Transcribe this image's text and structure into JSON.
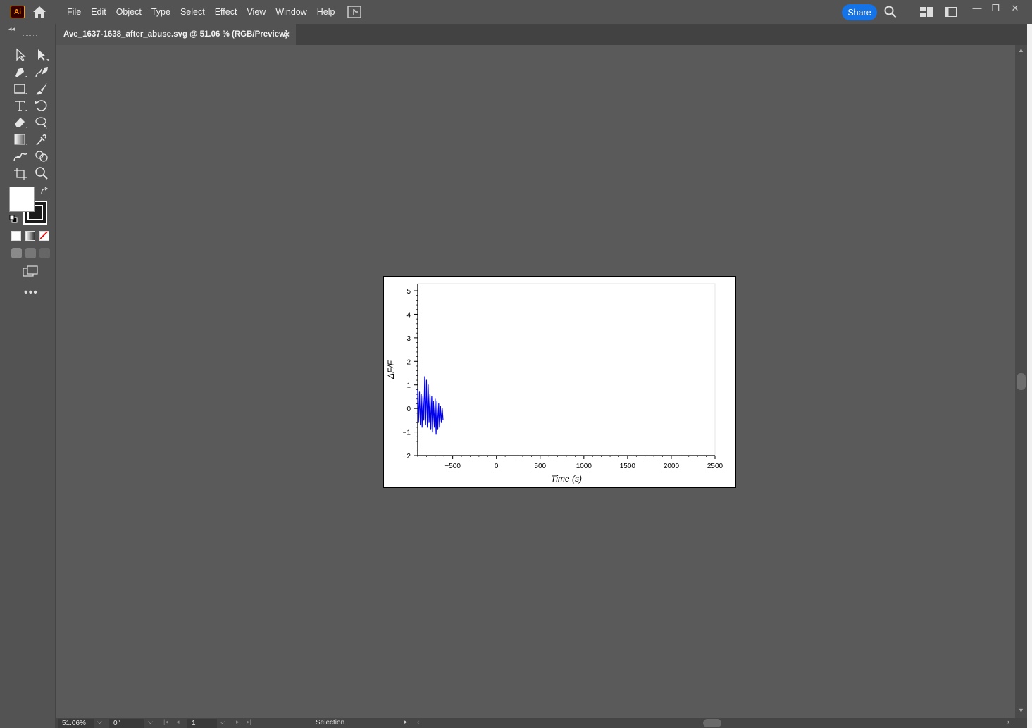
{
  "app": {
    "logo_text": "Ai"
  },
  "menu": [
    "File",
    "Edit",
    "Object",
    "Type",
    "Select",
    "Effect",
    "View",
    "Window",
    "Help"
  ],
  "share_label": "Share",
  "window_controls": {
    "minimize": "—",
    "restore": "❐",
    "close": "✕"
  },
  "document_tab": {
    "title": "Ave_1637-1638_after_abuse.svg @ 51.06 % (RGB/Preview)",
    "close": "×"
  },
  "toolbar": {
    "collapse": "◂◂",
    "more": "•••"
  },
  "status": {
    "zoom": "51.06%",
    "rotation": "0°",
    "artboard": "1",
    "tool": "Selection"
  },
  "colors": {
    "accent": "#1473e6",
    "series": "#0000ee",
    "ui_bg": "#535353"
  },
  "icons": [
    "home-icon",
    "arrange-documents-icon",
    "search-icon",
    "workspace-icon",
    "panel-icon",
    "selection-tool-icon",
    "direct-selection-tool-icon",
    "pen-tool-icon",
    "curvature-tool-icon",
    "rectangle-tool-icon",
    "paintbrush-tool-icon",
    "type-tool-icon",
    "rotate-tool-icon",
    "eraser-tool-icon",
    "lasso-tool-icon",
    "gradient-tool-icon",
    "eyedropper-tool-icon",
    "puppet-warp-tool-icon",
    "shape-builder-tool-icon",
    "artboard-tool-icon",
    "zoom-tool-icon"
  ],
  "chart_data": {
    "type": "line",
    "title": "",
    "xlabel": "Time (s)",
    "ylabel": "ΔF/F",
    "xlim": [
      -900,
      2500
    ],
    "ylim": [
      -2,
      5.3
    ],
    "xticks": [
      -500,
      0,
      500,
      1000,
      1500,
      2000,
      2500
    ],
    "xtick_labels": [
      "−500",
      "0",
      "500",
      "1000",
      "1500",
      "2000",
      "2500"
    ],
    "yticks": [
      -2,
      -1,
      0,
      1,
      2,
      3,
      4,
      5
    ],
    "ytick_labels": [
      "−2",
      "−1",
      "0",
      "1",
      "2",
      "3",
      "4",
      "5"
    ],
    "grid": false,
    "series": [
      {
        "x": [
          -900,
          -890,
          -880,
          -870,
          -860,
          -850,
          -840,
          -830,
          -820,
          -810,
          -800,
          -790,
          -780,
          -770,
          -760,
          -750,
          -740,
          -730,
          -720,
          -710,
          -700,
          -690,
          -680,
          -670,
          -660,
          -650,
          -640,
          -630,
          -620,
          -610
        ],
        "y": [
          0.8,
          -0.6,
          0.7,
          -0.7,
          0.6,
          -0.8,
          0.5,
          -0.5,
          1.35,
          -0.7,
          1.2,
          -0.8,
          1.0,
          -0.6,
          0.6,
          -0.9,
          0.5,
          -1.0,
          0.3,
          -0.8,
          0.4,
          -1.1,
          0.3,
          -0.9,
          0.2,
          -0.8,
          0.1,
          -0.6,
          0.0,
          -0.5
        ]
      }
    ]
  }
}
